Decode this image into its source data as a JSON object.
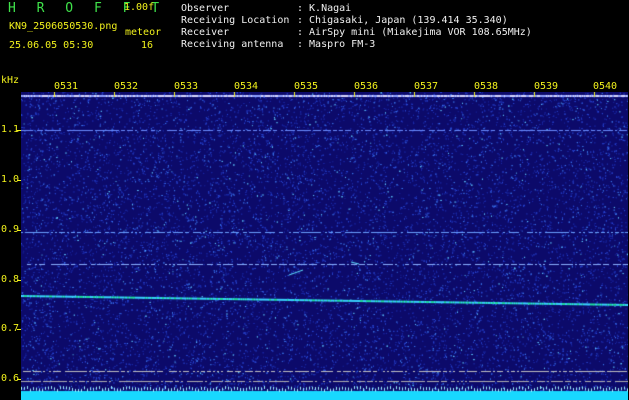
{
  "header": {
    "app_title": "H R O F F T",
    "version": "1.00f",
    "filename": "KN9_2506050530.png",
    "meteor_label": "meteor",
    "datetime": "25.06.05 05:30",
    "meteor_count": "16",
    "info": [
      {
        "key": "Observer",
        "value": ": K.Nagai"
      },
      {
        "key": "Receiving Location",
        "value": ": Chigasaki, Japan (139.414 35.340)"
      },
      {
        "key": "Receiver",
        "value": ": AirSpy mini (Miakejima VOR 108.65MHz)"
      },
      {
        "key": "Receiving antenna",
        "value": ": Maspro FM-3"
      }
    ]
  },
  "axis": {
    "unit": "kHz",
    "y_ticks": [
      "1.1",
      "1.0",
      "0.9",
      "0.8",
      "0.7",
      "0.6"
    ],
    "x_ticks": [
      "0531",
      "0532",
      "0533",
      "0534",
      "0535",
      "0536",
      "0537",
      "0538",
      "0539",
      "0540"
    ]
  },
  "colors": {
    "label": "#f2f21c",
    "title": "#3fe24a",
    "background": "#0c0a6a",
    "signal": "#39d3ff"
  }
}
